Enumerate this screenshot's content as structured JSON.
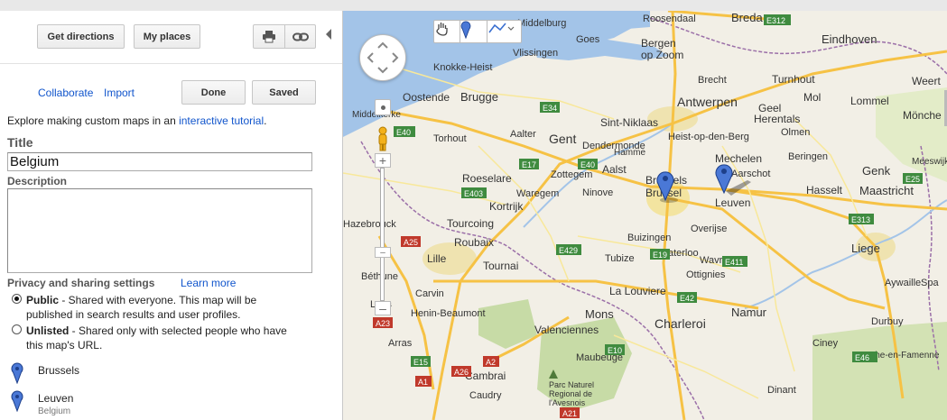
{
  "toolbar": {
    "get_directions": "Get directions",
    "my_places": "My places",
    "print_icon": "printer-icon",
    "link_icon": "link-icon"
  },
  "edit": {
    "collaborate": "Collaborate",
    "import": "Import",
    "done": "Done",
    "saved": "Saved"
  },
  "intro": {
    "prefix": "Explore making custom maps in an ",
    "link": "interactive tutorial",
    "suffix": "."
  },
  "form": {
    "title_label": "Title",
    "title_value": "Belgium",
    "description_label": "Description",
    "description_value": ""
  },
  "privacy": {
    "label": "Privacy and sharing settings",
    "learn_more": "Learn more",
    "public_title": "Public",
    "public_desc_1": " - Shared with everyone. This map will be",
    "public_desc_2": "published in search results and user profiles.",
    "unlisted_title": "Unlisted",
    "unlisted_desc_1": " - Shared only with selected people who have",
    "unlisted_desc_2": "this map's URL.",
    "selected": "public"
  },
  "places": [
    {
      "name": "Brussels",
      "sub": ""
    },
    {
      "name": "Leuven",
      "sub": "Belgium"
    }
  ],
  "colors": {
    "pin": "#4a78d6",
    "link": "#1155cc",
    "highway": "#f6c245",
    "road": "#f8e89a",
    "water": "#a3c4e8",
    "forest": "#c7dba6"
  },
  "map": {
    "cities": [
      {
        "name": "Roosendaal"
      },
      {
        "name": "Breda"
      },
      {
        "name": "Eindhoven"
      },
      {
        "name": "Middelburg"
      },
      {
        "name": "Goes"
      },
      {
        "name": "Bergen"
      },
      {
        "name": "op Zoom"
      },
      {
        "name": "Vlissingen"
      },
      {
        "name": "Knokke-Heist"
      },
      {
        "name": "Brecht"
      },
      {
        "name": "Turnhout"
      },
      {
        "name": "Weert"
      },
      {
        "name": "Oostende"
      },
      {
        "name": "Brugge"
      },
      {
        "name": "Antwerpen"
      },
      {
        "name": "Geel"
      },
      {
        "name": "Mol"
      },
      {
        "name": "Lommel"
      },
      {
        "name": "Middelkerke"
      },
      {
        "name": "Sint-Niklaas"
      },
      {
        "name": "Herentals"
      },
      {
        "name": "Mönche"
      },
      {
        "name": "Torhout"
      },
      {
        "name": "Aalter"
      },
      {
        "name": "Gent"
      },
      {
        "name": "Dendermonde"
      },
      {
        "name": "Heist-op-den-Berg"
      },
      {
        "name": "Olmen"
      },
      {
        "name": "Genk"
      },
      {
        "name": "Mechelen"
      },
      {
        "name": "Beringen"
      },
      {
        "name": "Aalst"
      },
      {
        "name": "Aarschot"
      },
      {
        "name": "Meeswijk"
      },
      {
        "name": "Roeselare"
      },
      {
        "name": "Waregem"
      },
      {
        "name": "Brussels"
      },
      {
        "name": "Brussel"
      },
      {
        "name": "Leuven"
      },
      {
        "name": "Hasselt"
      },
      {
        "name": "Maastricht"
      },
      {
        "name": "Kortrijk"
      },
      {
        "name": "Tourcoing"
      },
      {
        "name": "Overijse"
      },
      {
        "name": "Hazebrouck"
      },
      {
        "name": "Roubaix"
      },
      {
        "name": "Buizingen"
      },
      {
        "name": "Liege"
      },
      {
        "name": "Lille"
      },
      {
        "name": "Tournai"
      },
      {
        "name": "Béthune"
      },
      {
        "name": "La Louviere"
      },
      {
        "name": "Carvin"
      },
      {
        "name": "Lens"
      },
      {
        "name": "Henin-Beaumont"
      },
      {
        "name": "Mons"
      },
      {
        "name": "Charleroi"
      },
      {
        "name": "Namur"
      },
      {
        "name": "Arras"
      },
      {
        "name": "Valenciennes"
      },
      {
        "name": "Maubeuge"
      },
      {
        "name": "Cambrai"
      },
      {
        "name": "Caudry"
      },
      {
        "name": "Parc Naturel"
      },
      {
        "name": "Regional de"
      },
      {
        "name": "l'Avesnois"
      },
      {
        "name": "Dinant"
      },
      {
        "name": "Marche-en-Famenne"
      },
      {
        "name": "Spa"
      },
      {
        "name": "Aywaille"
      },
      {
        "name": "Ciney"
      },
      {
        "name": "Durbuy"
      },
      {
        "name": "Wavre"
      },
      {
        "name": "Tubize"
      },
      {
        "name": "Waterloo"
      },
      {
        "name": "Ottignies"
      },
      {
        "name": "Zottegem"
      },
      {
        "name": "Ninove"
      },
      {
        "name": "Hamme"
      }
    ],
    "roads": [
      {
        "label": "E312"
      },
      {
        "label": "E34"
      },
      {
        "label": "E40"
      },
      {
        "label": "E17"
      },
      {
        "label": "E403"
      },
      {
        "label": "E19"
      },
      {
        "label": "E411"
      },
      {
        "label": "E42"
      },
      {
        "label": "E25"
      },
      {
        "label": "E429"
      },
      {
        "label": "A25"
      },
      {
        "label": "A26"
      },
      {
        "label": "A2"
      },
      {
        "label": "A1"
      },
      {
        "label": "E15"
      },
      {
        "label": "E313"
      },
      {
        "label": "E46"
      },
      {
        "label": "A21"
      },
      {
        "label": "A23"
      },
      {
        "label": "E10"
      }
    ]
  }
}
